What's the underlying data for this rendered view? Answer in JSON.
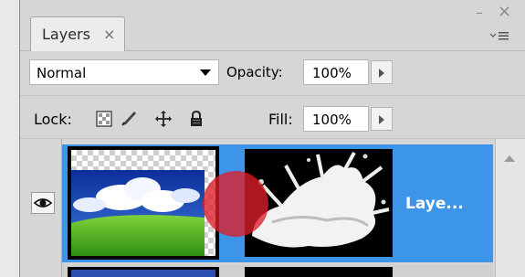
{
  "window": {
    "minimize_glyph": "–",
    "close_glyph": "×"
  },
  "tab": {
    "label": "Layers",
    "close_glyph": "×",
    "menu_icon": "panel-menu-icon"
  },
  "blend_mode": {
    "value": "Normal"
  },
  "opacity": {
    "label": "Opacity:",
    "value": "100%"
  },
  "lock": {
    "label": "Lock:",
    "icons": [
      "lock-transparent-pixels-icon",
      "lock-image-pixels-icon",
      "lock-position-icon",
      "lock-all-icon"
    ]
  },
  "fill": {
    "label": "Fill:",
    "value": "100%"
  },
  "layers": [
    {
      "name": "Laye...",
      "visible": true,
      "selected": true,
      "has_mask": true
    },
    {
      "name": "",
      "visible": false,
      "selected": false,
      "has_mask": true
    }
  ],
  "colors": {
    "selection": "#3d95ea",
    "panel": "#d6d6d6",
    "cursor_marker": "#de1e28"
  }
}
